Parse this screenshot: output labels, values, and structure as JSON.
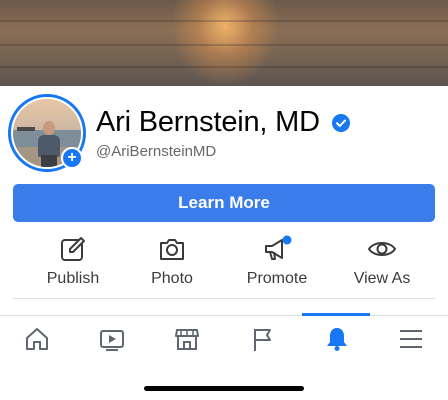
{
  "profile": {
    "name": "Ari Bernstein, MD",
    "handle": "@AriBernsteinMD",
    "add_symbol": "+"
  },
  "cta": {
    "label": "Learn More"
  },
  "actions": [
    {
      "label": "Publish",
      "icon": "edit-icon"
    },
    {
      "label": "Photo",
      "icon": "camera-icon"
    },
    {
      "label": "Promote",
      "icon": "megaphone-icon"
    },
    {
      "label": "View As",
      "icon": "eye-icon"
    }
  ],
  "tabbar": {
    "tabs": [
      {
        "icon": "home-icon"
      },
      {
        "icon": "watch-icon"
      },
      {
        "icon": "marketplace-icon"
      },
      {
        "icon": "pages-flag-icon"
      },
      {
        "icon": "notifications-bell-icon",
        "active": true
      },
      {
        "icon": "menu-icon"
      }
    ]
  },
  "colors": {
    "accent": "#1877f2",
    "button": "#3a7ce9",
    "text": "#050505",
    "secondary_text": "#65676b",
    "notification_dot": "#1877f2"
  }
}
